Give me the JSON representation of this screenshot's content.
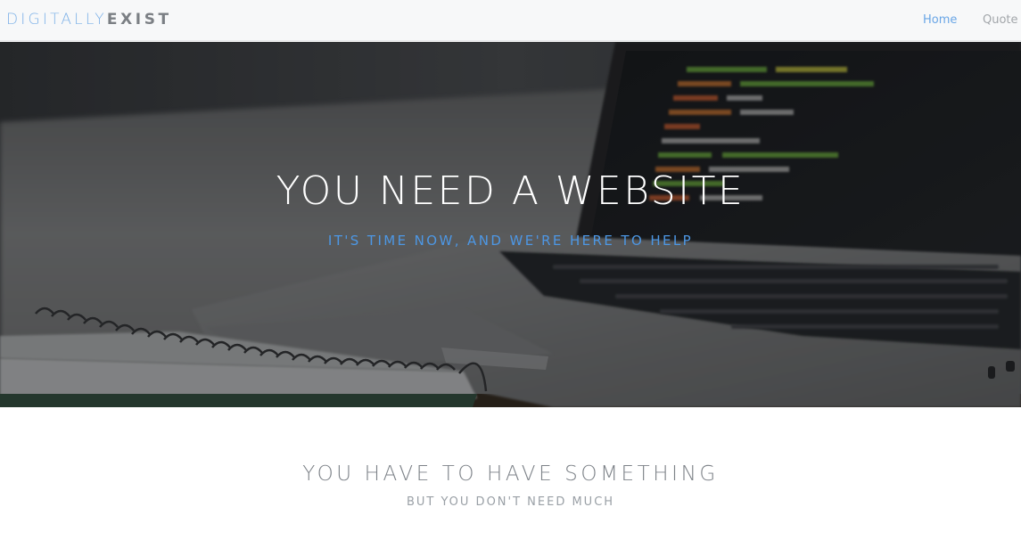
{
  "navbar": {
    "brand": {
      "light": "DIGITALLY",
      "bold": "EXIST",
      "light_color": "#7fb2e8",
      "bold_color": "#7b7f84"
    },
    "links": [
      {
        "label": "Home",
        "active": true
      },
      {
        "label": "Quote",
        "active": false
      }
    ],
    "active_color": "#6aa6e6"
  },
  "hero": {
    "title": "YOU NEED A WEBSITE",
    "subtitle": "IT'S TIME NOW, AND WE'RE HERE TO HELP",
    "subtitle_color": "#4d97e4",
    "background_image": "laptop-and-notebook-photo"
  },
  "section": {
    "title": "YOU HAVE TO HAVE SOMETHING",
    "subtitle": "BUT YOU DON'T NEED MUCH"
  }
}
